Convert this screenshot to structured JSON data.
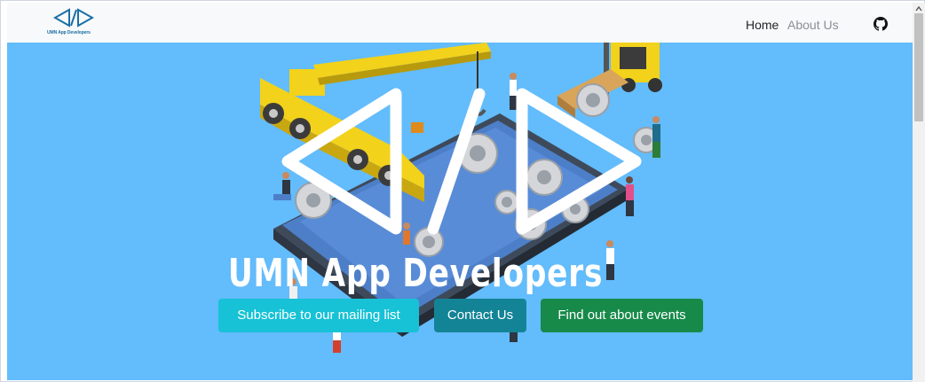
{
  "navbar": {
    "brand_name": "UMN App Developers",
    "links": [
      {
        "label": "Home"
      },
      {
        "label": "About Us"
      }
    ],
    "github_icon": "github-icon"
  },
  "hero": {
    "title": "UMN App Developers",
    "buttons": [
      {
        "label": "Subscribe to our mailing list",
        "color": "#17c2d6"
      },
      {
        "label": "Contact Us",
        "color": "#138496"
      },
      {
        "label": "Find out about events",
        "color": "#178a4a"
      }
    ],
    "background_color": "#63bcfb"
  },
  "colors": {
    "navbar_bg": "#f8f9fa",
    "brand_blue": "#1b6fa6"
  }
}
